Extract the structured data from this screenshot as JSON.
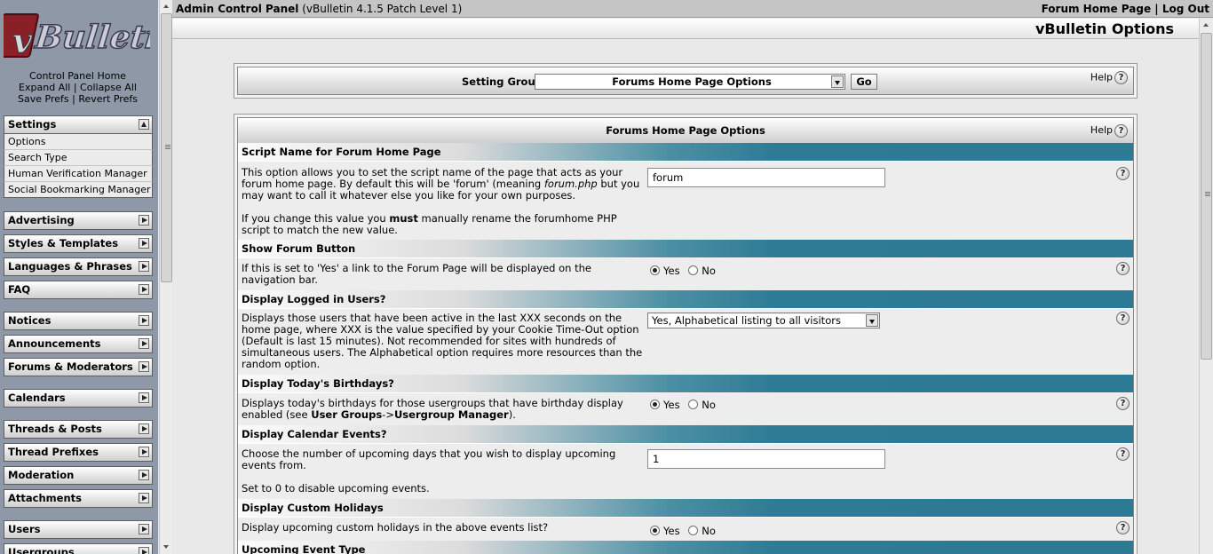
{
  "nav": {
    "logo_text": "vBulletin",
    "links_line1": "Control Panel Home",
    "links_line2a": "Expand All",
    "links_line2b": "Collapse All",
    "links_line3a": "Save Prefs",
    "links_line3b": "Revert Prefs",
    "groups": [
      {
        "label": "Settings",
        "items": [
          "Options",
          "Search Type",
          "Human Verification Manager",
          "Social Bookmarking Manager"
        ]
      },
      {
        "label": "Advertising"
      },
      {
        "label": "Styles & Templates"
      },
      {
        "label": "Languages & Phrases"
      },
      {
        "label": "FAQ"
      },
      {
        "label": "Notices"
      },
      {
        "label": "Announcements"
      },
      {
        "label": "Forums & Moderators"
      },
      {
        "label": "Calendars"
      },
      {
        "label": "Threads & Posts"
      },
      {
        "label": "Thread Prefixes"
      },
      {
        "label": "Moderation"
      },
      {
        "label": "Attachments"
      },
      {
        "label": "Users"
      },
      {
        "label": "Usergroups"
      }
    ]
  },
  "topbar": {
    "title_bold": "Admin Control Panel",
    "title_version": "(vBulletin 4.1.5 Patch Level 1)",
    "link_forum_home": "Forum Home Page",
    "link_sep": "|",
    "link_logout": "Log Out"
  },
  "page_title": "vBulletin Options",
  "setting_group": {
    "label": "Setting Group",
    "selected": "Forums Home Page Options",
    "go": "Go",
    "help": "Help"
  },
  "options_panel": {
    "title": "Forums Home Page Options",
    "help": "Help",
    "sections": [
      {
        "title": "Script Name for Forum Home Page",
        "desc1": "This option allows you to set the script name of the page that acts as your forum home page. By default this will be 'forum' (meaning ",
        "desc_em": "forum.php",
        "desc2": " but you may want to call it whatever else you like for your own purposes.",
        "desc3a": "If you change this value you ",
        "desc3b": "must",
        "desc3c": " manually rename the forumhome PHP script to match the new value.",
        "value": "forum"
      },
      {
        "title": "Show Forum Button",
        "desc": "If this is set to 'Yes' a link to the Forum Page will be displayed on the navigation bar.",
        "yes": "Yes",
        "no": "No"
      },
      {
        "title": "Display Logged in Users?",
        "desc": "Displays those users that have been active in the last XXX seconds on the home page, where XXX is the value specified by your Cookie Time-Out option (Default is last 15 minutes). Not recommended for sites with hundreds of simultaneous users. The Alphabetical option requires more resources than the random option.",
        "selected": "Yes, Alphabetical listing to all visitors"
      },
      {
        "title": "Display Today's Birthdays?",
        "desc1": "Displays today's birthdays for those usergroups that have birthday display enabled (see ",
        "desc_b1": "User Groups",
        "desc_mid": "->",
        "desc_b2": "Usergroup Manager",
        "desc2": ").",
        "yes": "Yes",
        "no": "No"
      },
      {
        "title": "Display Calendar Events?",
        "desc1": "Choose the number of upcoming days that you wish to display upcoming events from.",
        "desc2": "Set to 0 to disable upcoming events.",
        "value": "1"
      },
      {
        "title": "Display Custom Holidays",
        "desc": "Display upcoming custom holidays in the above events list?",
        "yes": "Yes",
        "no": "No"
      },
      {
        "title": "Upcoming Event Type"
      }
    ]
  }
}
